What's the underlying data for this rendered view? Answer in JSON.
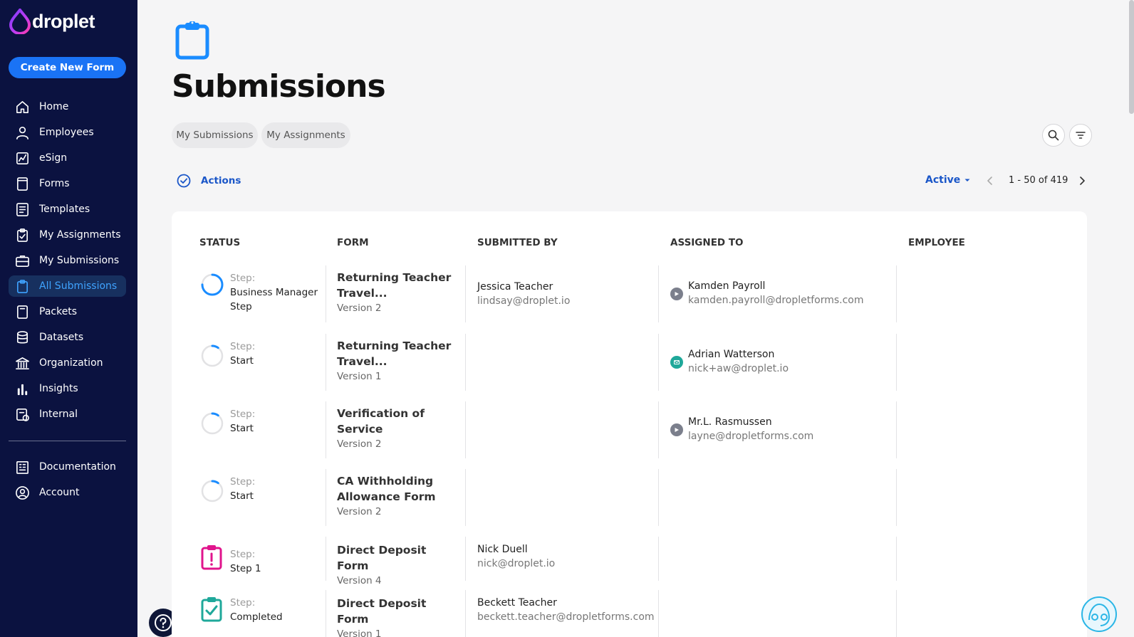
{
  "app": {
    "brand": "droplet"
  },
  "sidebar": {
    "create_label": "Create New Form",
    "items": [
      {
        "label": "Home",
        "icon": "home-icon"
      },
      {
        "label": "Employees",
        "icon": "person-icon"
      },
      {
        "label": "eSign",
        "icon": "esign-icon"
      },
      {
        "label": "Forms",
        "icon": "form-icon"
      },
      {
        "label": "Templates",
        "icon": "template-icon"
      },
      {
        "label": "My Assignments",
        "icon": "clipboard-check-icon"
      },
      {
        "label": "My Submissions",
        "icon": "briefcase-icon"
      },
      {
        "label": "All Submissions",
        "icon": "clipboard-icon",
        "active": true
      },
      {
        "label": "Packets",
        "icon": "packet-icon"
      },
      {
        "label": "Datasets",
        "icon": "database-icon"
      },
      {
        "label": "Organization",
        "icon": "building-icon"
      },
      {
        "label": "Insights",
        "icon": "bar-chart-icon"
      },
      {
        "label": "Internal",
        "icon": "internal-icon"
      }
    ],
    "secondary": [
      {
        "label": "Documentation",
        "icon": "documentation-icon"
      },
      {
        "label": "Account",
        "icon": "account-icon"
      }
    ]
  },
  "main": {
    "title": "Submissions",
    "tabs": [
      "My Submissions",
      "My Assignments"
    ],
    "actions_label": "Actions",
    "filter_label": "Active",
    "pagination": "1 - 50 of 419"
  },
  "table": {
    "headers": [
      "STATUS",
      "FORM",
      "SUBMITTED BY",
      "ASSIGNED TO",
      "EMPLOYEE"
    ],
    "rows": [
      {
        "step_label": "Step:",
        "step": "Business Manager Step",
        "status_icon": "progress-ring-icon",
        "progress": 0.75,
        "form": "Returning Teacher Travel...",
        "version": "Version 2",
        "submitted_name": "Jessica Teacher",
        "submitted_email": "lindsay@droplet.io",
        "assigned_name": "Kamden Payroll",
        "assigned_email": "kamden.payroll@dropletforms.com",
        "assigned_icon": "send-icon",
        "assigned_color": "#7b7f8c"
      },
      {
        "step_label": "Step:",
        "step": "Start",
        "status_icon": "progress-ring-icon",
        "progress": 0.1,
        "form": "Returning Teacher Travel...",
        "version": "Version 1",
        "submitted_name": "",
        "submitted_email": "",
        "assigned_name": "Adrian Watterson",
        "assigned_email": "nick+aw@droplet.io",
        "assigned_icon": "mail-icon",
        "assigned_color": "#1fa89a"
      },
      {
        "step_label": "Step:",
        "step": "Start",
        "status_icon": "progress-ring-icon",
        "progress": 0.1,
        "form": "Verification of Service",
        "version": "Version 2",
        "submitted_name": "",
        "submitted_email": "",
        "assigned_name": "Mr.L. Rasmussen",
        "assigned_email": "layne@dropletforms.com",
        "assigned_icon": "send-icon",
        "assigned_color": "#7b7f8c"
      },
      {
        "step_label": "Step:",
        "step": "Start",
        "status_icon": "progress-ring-icon",
        "progress": 0.1,
        "form": "CA Withholding Allowance Form",
        "version": "Version 2",
        "submitted_name": "",
        "submitted_email": "",
        "assigned_name": "",
        "assigned_email": "",
        "assigned_icon": "",
        "assigned_color": ""
      },
      {
        "step_label": "Step:",
        "step": "Step 1",
        "status_icon": "clipboard-alert-icon",
        "progress": null,
        "form": "Direct Deposit Form",
        "version": "Version 4",
        "submitted_name": "Nick Duell",
        "submitted_email": "nick@droplet.io",
        "assigned_name": "",
        "assigned_email": "",
        "assigned_icon": "",
        "assigned_color": ""
      },
      {
        "step_label": "Step:",
        "step": "Completed",
        "status_icon": "clipboard-check-icon",
        "progress": null,
        "form": "Direct Deposit Form",
        "version": "Version 1",
        "submitted_name": "Beckett Teacher",
        "submitted_email": "beckett.teacher@dropletforms.com",
        "assigned_name": "",
        "assigned_email": "",
        "assigned_icon": "",
        "assigned_color": ""
      }
    ]
  },
  "colors": {
    "sidebar": "#0b1240",
    "accent": "#1a73f5",
    "link": "#1a56c8",
    "alert": "#e0148c",
    "complete": "#1fa89a"
  }
}
